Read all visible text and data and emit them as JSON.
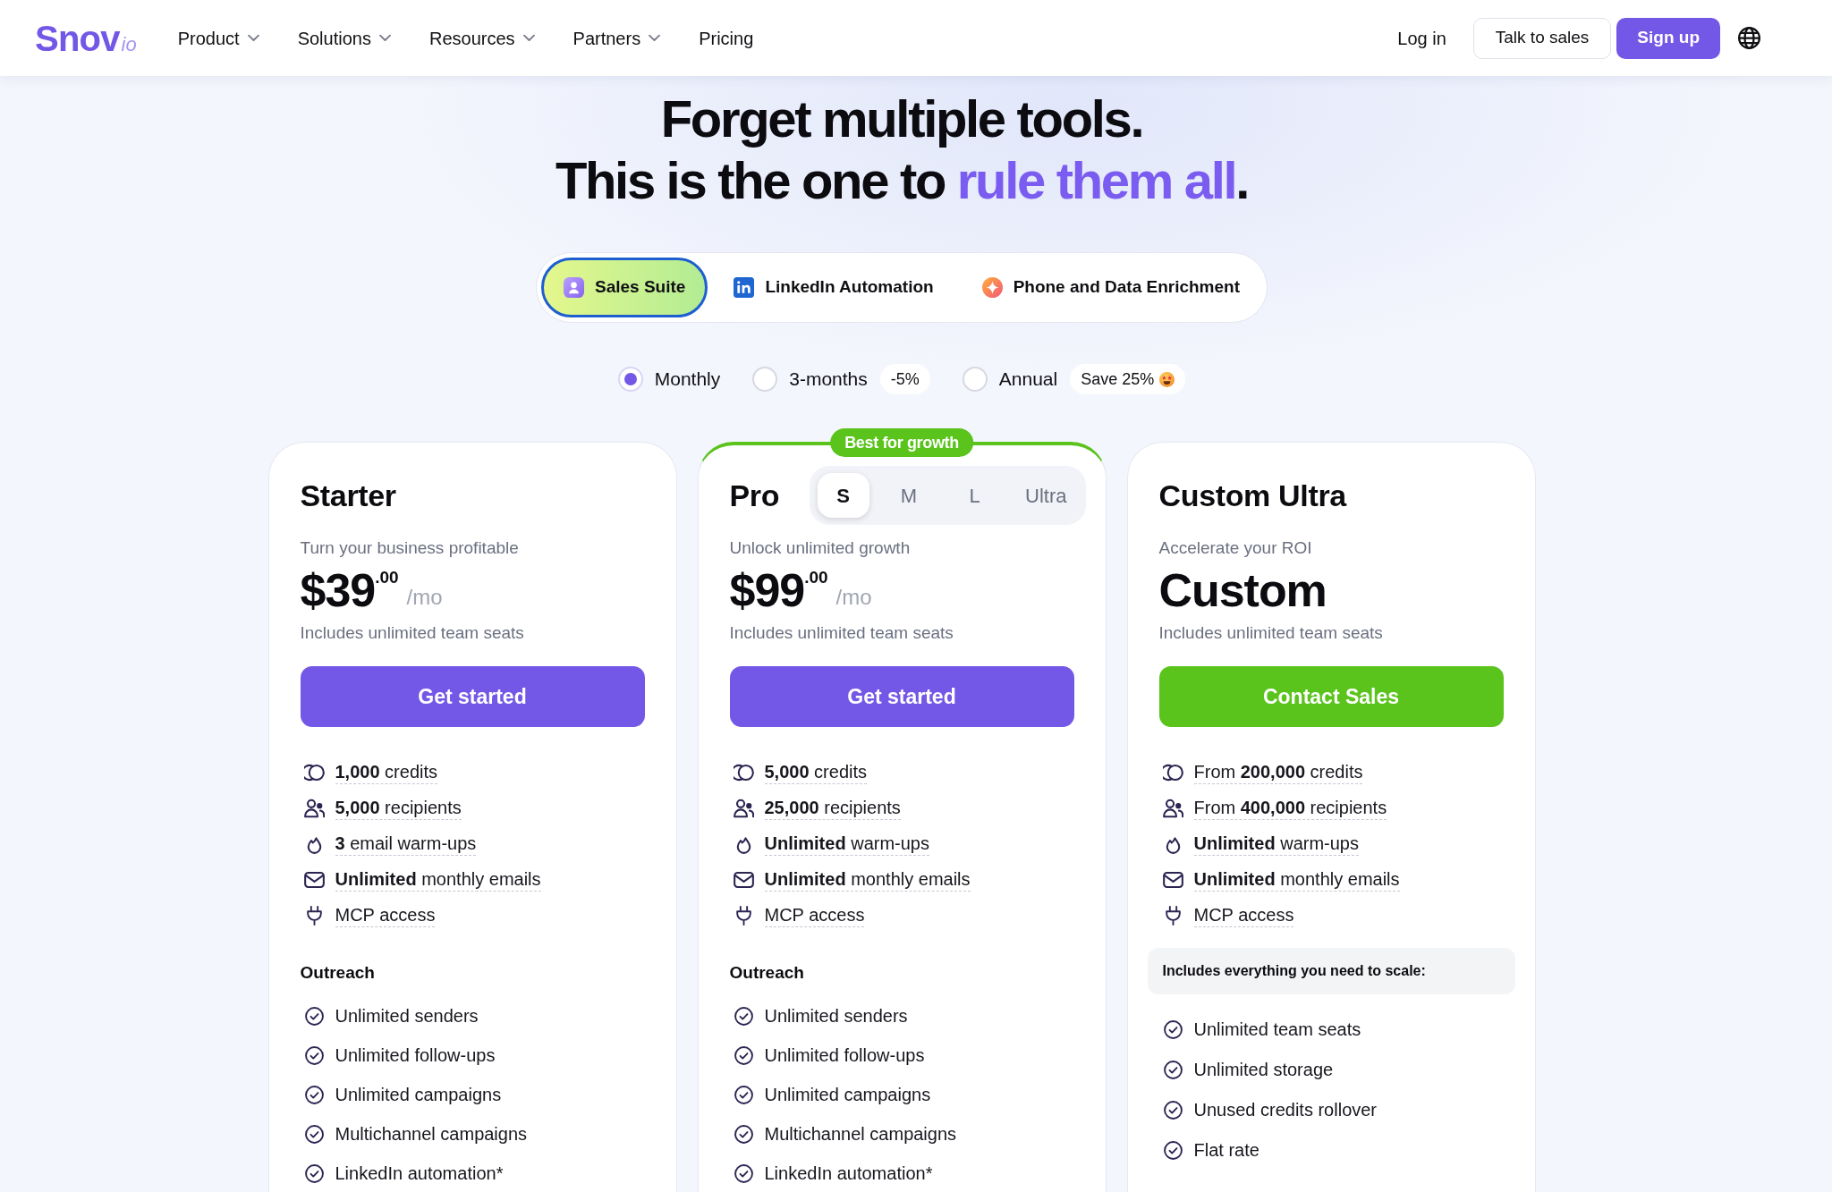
{
  "header": {
    "logo": {
      "wordmark": "Snov",
      "suffix": "io"
    },
    "nav": [
      {
        "label": "Product",
        "has_menu": true
      },
      {
        "label": "Solutions",
        "has_menu": true
      },
      {
        "label": "Resources",
        "has_menu": true
      },
      {
        "label": "Partners",
        "has_menu": true
      },
      {
        "label": "Pricing",
        "has_menu": false
      }
    ],
    "login": "Log in",
    "talk_to_sales": "Talk to sales",
    "signup": "Sign up"
  },
  "headline": {
    "line_1": "Forget multiple tools.",
    "line_2": [
      {
        "text": "This is the one to ",
        "highlight": false
      },
      {
        "text": "rule them all",
        "highlight": true
      },
      {
        "text": ".",
        "highlight": false
      }
    ]
  },
  "product_tabs": [
    {
      "label": "Sales Suite",
      "kind": "sales",
      "selected": true
    },
    {
      "label": "LinkedIn Automation",
      "kind": "linkedin",
      "selected": false
    },
    {
      "label": "Phone and Data Enrichment",
      "kind": "enrichment",
      "selected": false
    }
  ],
  "billing_periods": [
    {
      "label": "Monthly",
      "selected": true
    },
    {
      "label": "3-months",
      "selected": false,
      "badge": {
        "text": "-5%",
        "emoji": false
      }
    },
    {
      "label": "Annual",
      "selected": false,
      "badge": {
        "text": "Save 25%",
        "emoji": true
      }
    }
  ],
  "plans": [
    {
      "name": "Starter",
      "featured": false,
      "tagline": "Turn your business profitable",
      "price": {
        "kind": "amount",
        "main": "$39",
        "cents": ".00",
        "period": "/mo"
      },
      "seats_note": "Includes unlimited team seats",
      "cta": {
        "label": "Get started",
        "kind": "primary"
      },
      "limits": [
        {
          "kind": "credits",
          "text": "**1,000** credits"
        },
        {
          "kind": "recipients",
          "text": "**5,000** recipients"
        },
        {
          "kind": "warmups",
          "text": "**3** email warm-ups"
        },
        {
          "kind": "emails",
          "text": "**Unlimited** monthly emails"
        },
        {
          "kind": "mcp",
          "text": "MCP access"
        }
      ],
      "section": {
        "kind": "heading",
        "text": "Outreach"
      },
      "features": [
        "Unlimited senders",
        "Unlimited follow-ups",
        "Unlimited campaigns",
        "Multichannel campaigns",
        "LinkedIn automation*"
      ]
    },
    {
      "name": "Pro",
      "featured": true,
      "ribbon": "Best for growth",
      "sizes": [
        {
          "label": "S",
          "selected": true
        },
        {
          "label": "M",
          "selected": false
        },
        {
          "label": "L",
          "selected": false
        },
        {
          "label": "Ultra",
          "selected": false
        }
      ],
      "tagline": "Unlock unlimited growth",
      "price": {
        "kind": "amount",
        "main": "$99",
        "cents": ".00",
        "period": "/mo"
      },
      "seats_note": "Includes unlimited team seats",
      "cta": {
        "label": "Get started",
        "kind": "primary"
      },
      "limits": [
        {
          "kind": "credits",
          "text": "**5,000** credits"
        },
        {
          "kind": "recipients",
          "text": "**25,000** recipients"
        },
        {
          "kind": "warmups",
          "text": "**Unlimited** warm-ups"
        },
        {
          "kind": "emails",
          "text": "**Unlimited** monthly emails"
        },
        {
          "kind": "mcp",
          "text": "MCP access"
        }
      ],
      "section": {
        "kind": "heading",
        "text": "Outreach"
      },
      "features": [
        "Unlimited senders",
        "Unlimited follow-ups",
        "Unlimited campaigns",
        "Multichannel campaigns",
        "LinkedIn automation*"
      ]
    },
    {
      "name": "Custom Ultra",
      "featured": false,
      "tagline": "Accelerate your ROI",
      "price": {
        "kind": "custom",
        "main": "Custom"
      },
      "seats_note": "Includes unlimited team seats",
      "cta": {
        "label": "Contact Sales",
        "kind": "sales"
      },
      "limits": [
        {
          "kind": "credits",
          "text": "From **200,000** credits"
        },
        {
          "kind": "recipients",
          "text": "From **400,000** recipients"
        },
        {
          "kind": "warmups",
          "text": "**Unlimited** warm-ups"
        },
        {
          "kind": "emails",
          "text": "**Unlimited** monthly emails"
        },
        {
          "kind": "mcp",
          "text": "MCP access"
        }
      ],
      "section": {
        "kind": "callout",
        "text": "Includes everything you need to scale:"
      },
      "features": [
        "Unlimited team seats",
        "Unlimited storage",
        "Unused credits rollover",
        "Flat rate"
      ]
    }
  ]
}
